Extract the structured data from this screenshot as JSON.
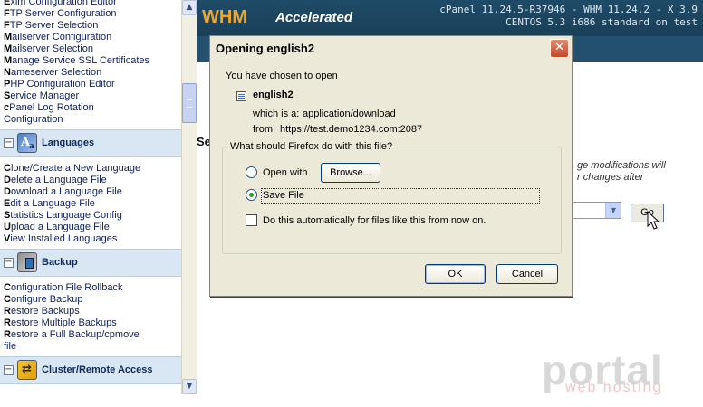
{
  "header": {
    "logo_main": "WHM",
    "logo_accent": "Accelerated",
    "info_line1": "cPanel 11.24.5-R37946 - WHM 11.24.2 - X 3.9",
    "info_line2": "CENTOS 5.3 i686 standard on test"
  },
  "sidebar": {
    "top_items": [
      {
        "key": "E",
        "rest": "xim Configuration Editor"
      },
      {
        "key": "F",
        "rest": "TP Server Configuration"
      },
      {
        "key": "F",
        "rest": "TP Server Selection"
      },
      {
        "key": "M",
        "rest": "ailserver Configuration"
      },
      {
        "key": "M",
        "rest": "ailserver Selection"
      },
      {
        "key": "M",
        "rest": "anage Service SSL Certificates"
      },
      {
        "key": "N",
        "rest": "ameserver Selection"
      },
      {
        "key": "P",
        "rest": "HP Configuration Editor"
      },
      {
        "key": "S",
        "rest": "ervice Manager"
      },
      {
        "key": "c",
        "rest": "Panel Log Rotation"
      },
      {
        "key": "",
        "rest": "Configuration"
      }
    ],
    "languages": {
      "title": "Languages",
      "items": [
        {
          "key": "C",
          "rest": "lone/Create a New Language"
        },
        {
          "key": "D",
          "rest": "elete a Language File"
        },
        {
          "key": "D",
          "rest": "ownload a Language File"
        },
        {
          "key": "E",
          "rest": "dit a Language File"
        },
        {
          "key": "S",
          "rest": "tatistics Language Config"
        },
        {
          "key": "U",
          "rest": "pload a Language File"
        },
        {
          "key": "V",
          "rest": "iew Installed Languages"
        }
      ]
    },
    "backup": {
      "title": "Backup",
      "items": [
        {
          "key": "C",
          "rest": "onfiguration File Rollback"
        },
        {
          "key": "C",
          "rest": "onfigure Backup"
        },
        {
          "key": "R",
          "rest": "estore Backups"
        },
        {
          "key": "R",
          "rest": "estore Multiple Backups"
        },
        {
          "key": "R",
          "rest": "estore a Full Backup/cpmove"
        },
        {
          "key": "",
          "rest": "file"
        }
      ]
    },
    "cluster": {
      "title": "Cluster/Remote Access"
    },
    "toggle_glyph": "−"
  },
  "main": {
    "section_label": "Se",
    "note_line1": "ge modifications will",
    "note_line2": "r changes after",
    "go_label": "Go"
  },
  "dialog": {
    "title": "Opening english2",
    "intro": "You have chosen to open",
    "filename": "english2",
    "which_is_label": "which is a:",
    "which_is_value": "application/download",
    "from_label": "from:",
    "from_value": "https://test.demo1234.com:2087",
    "question": "What should Firefox do with this file?",
    "open_with_label": "Open with",
    "browse_label": "Browse...",
    "save_file_label": "Save File",
    "auto_label": "Do this automatically for files like this from now on.",
    "ok_label": "OK",
    "cancel_label": "Cancel",
    "selected_action": "Save File",
    "auto_checked": false
  },
  "watermark": {
    "line1": "portal",
    "line2": "web hosting"
  },
  "icons": {
    "close": "close-icon",
    "scroll_up": "scroll-up-icon",
    "scroll_down": "scroll-down-icon",
    "dropdown": "chevron-down-icon"
  },
  "colors": {
    "header_bg": "#1e4b67",
    "logo": "#f0a52a",
    "section_bg": "#d8e7f3",
    "dialog_bg": "#ece9d8",
    "close_btn": "#c14a2b"
  }
}
